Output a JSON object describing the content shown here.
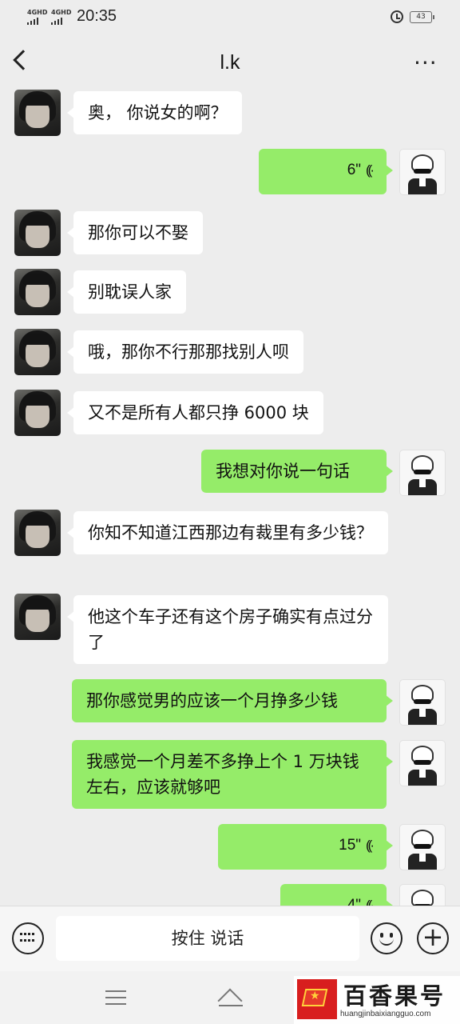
{
  "status_bar": {
    "signal_1": "4GHD",
    "signal_2": "4GHD",
    "time": "20:35",
    "battery": "43"
  },
  "header": {
    "title": "l.k",
    "more_glyph": "···",
    "icons": [
      "back-arrow-icon",
      "more-dots-icon"
    ]
  },
  "messages": [
    {
      "side": "in",
      "text": "奥， 你说女的啊？"
    },
    {
      "side": "out",
      "voice": true,
      "duration": "6\"",
      "wave": "((·"
    },
    {
      "side": "in",
      "text": "那你可以不娶"
    },
    {
      "side": "in",
      "text": "别耽误人家"
    },
    {
      "side": "in",
      "text": "哦，那你不行那那找别人呗"
    },
    {
      "side": "in",
      "text": "又不是所有人都只挣 6000 块"
    },
    {
      "side": "out",
      "text": "我想对你说一句话"
    },
    {
      "side": "in",
      "text": "你知不知道江西那边有裁里有多少钱？"
    },
    {
      "side": "in",
      "text": "他这个车子还有这个房子确实有点过分了"
    },
    {
      "side": "out",
      "text": "那你感觉男的应该一个月挣多少钱"
    },
    {
      "side": "out",
      "text": "我感觉一个月差不多挣上个 1 万块钱左右，应该就够吧"
    },
    {
      "side": "out",
      "voice": true,
      "duration": "15\"",
      "wave": "((·"
    },
    {
      "side": "out",
      "voice": true,
      "duration": "4\"",
      "wave": "((·"
    }
  ],
  "input_bar": {
    "hold_to_talk": "按住 说话",
    "plus_glyph": "+",
    "icons": [
      "keyboard-icon",
      "emoji-icon",
      "plus-icon"
    ]
  },
  "nav_bar": {
    "icons": [
      "menu-icon",
      "home-icon"
    ]
  },
  "watermark": {
    "name": "百香果号",
    "url": "huangjinbaixiangguo.com",
    "star": "★"
  },
  "colors": {
    "background": "#ededed",
    "outgoing_bubble": "#95ec69",
    "incoming_bubble": "#ffffff",
    "watermark_red": "#d81e1e"
  }
}
